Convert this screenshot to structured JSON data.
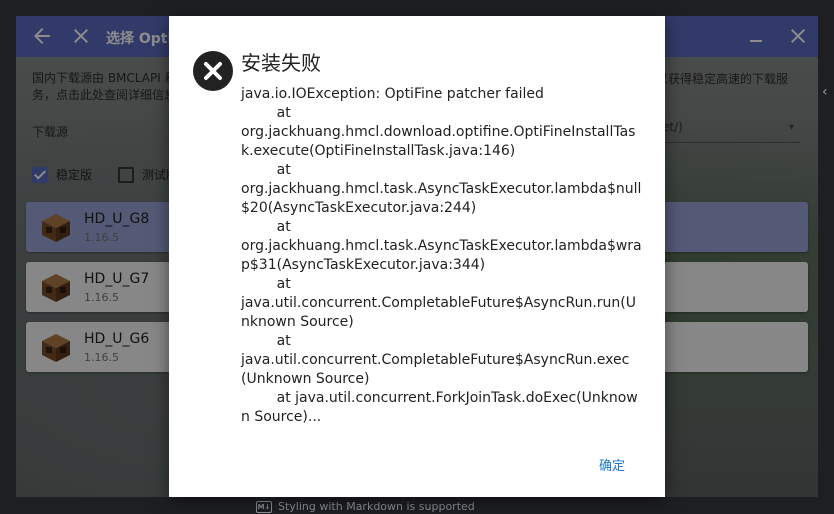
{
  "window": {
    "title": "选择 Optifine",
    "back_icon": "arrow-left-icon",
    "close_icon": "close-icon",
    "minimize_icon": "minimize-icon",
    "window_close_icon": "close-icon"
  },
  "download_hint": "国内下载源由 BMCLAPI 和",
  "download_hint_line2": "务，点击此处查阅详细信息",
  "download_hint_right": "以获得稳定高速的下载服",
  "download_source": {
    "label": "下载源",
    "selected": "et/)"
  },
  "filters": {
    "stable_label": "稳定版",
    "stable_checked": true,
    "test_label": "测试版",
    "test_checked": false
  },
  "versions": [
    {
      "name": "HD_U_G8",
      "mc": "1.16.5",
      "selected": true
    },
    {
      "name": "HD_U_G7",
      "mc": "1.16.5",
      "selected": false
    },
    {
      "name": "HD_U_G6",
      "mc": "1.16.5",
      "selected": false
    }
  ],
  "dialog": {
    "icon": "error-x-icon",
    "title": "安装失败",
    "body": "java.io.IOException: OptiFine patcher failed\n\tat\norg.jackhuang.hmcl.download.optifine.OptiFineInstallTask.execute(OptiFineInstallTask.java:146)\n\tat\norg.jackhuang.hmcl.task.AsyncTaskExecutor.lambda$null$20(AsyncTaskExecutor.java:244)\n\tat\norg.jackhuang.hmcl.task.AsyncTaskExecutor.lambda$wrap$31(AsyncTaskExecutor.java:344)\n\tat\njava.util.concurrent.CompletableFuture$AsyncRun.run(Unknown Source)\n\tat\njava.util.concurrent.CompletableFuture$AsyncRun.exec(Unknown Source)\n\tat java.util.concurrent.ForkJoinTask.doExec(Unknown Source)...",
    "ok_label": "确定"
  },
  "background_note": "Styling with Markdown is supported",
  "colors": {
    "accent": "#5c6bc0",
    "selected_row": "#9aa2d8",
    "link": "#1976d2"
  }
}
